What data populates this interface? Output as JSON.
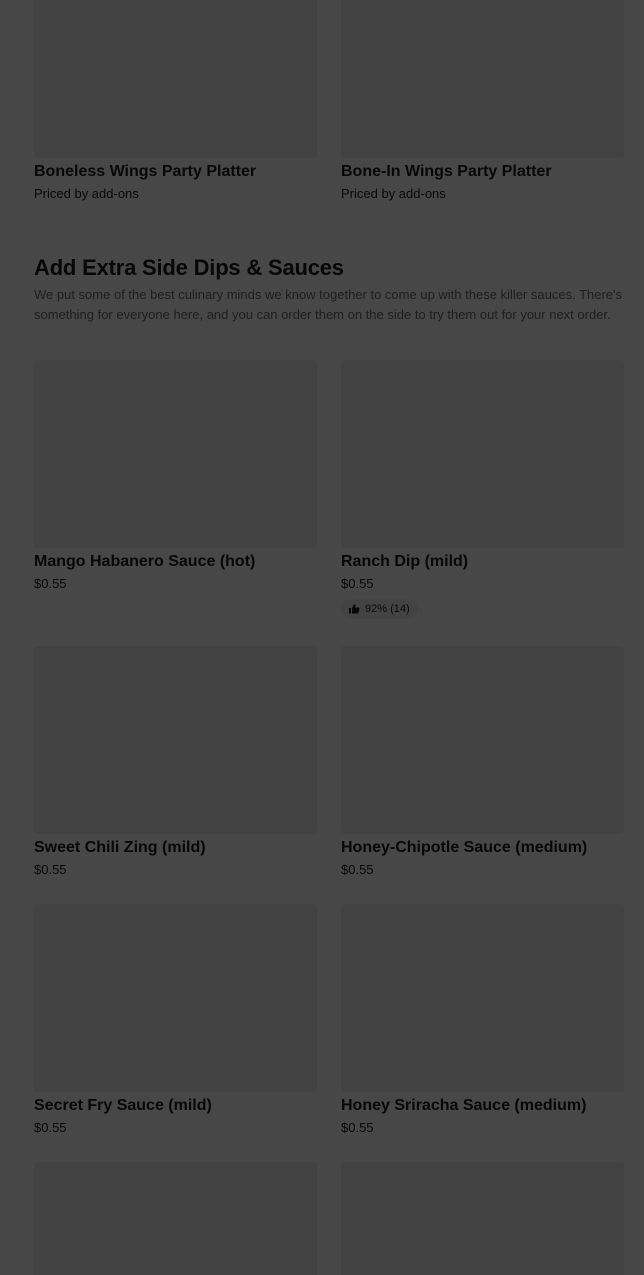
{
  "top_items": [
    {
      "name": "Boneless Wings Party Platter",
      "price": "Priced by add-ons"
    },
    {
      "name": "Bone-In Wings Party Platter",
      "price": "Priced by add-ons"
    }
  ],
  "section": {
    "title": "Add Extra Side Dips & Sauces",
    "description": "We put some of the best culinary minds we know together to come up with these killer sauces. There's something for everyone here, and you can order them on the side to try them out for your next order."
  },
  "items": [
    {
      "name": "Mango Habanero Sauce (hot)",
      "price": "$0.55"
    },
    {
      "name": "Ranch Dip (mild)",
      "price": "$0.55",
      "rating": "92% (14)"
    },
    {
      "name": "Sweet Chili Zing (mild)",
      "price": "$0.55"
    },
    {
      "name": "Honey-Chipotle Sauce (medium)",
      "price": "$0.55"
    },
    {
      "name": "Secret Fry Sauce (mild)",
      "price": "$0.55"
    },
    {
      "name": "Honey Sriracha Sauce (medium)",
      "price": "$0.55"
    }
  ],
  "icons": {
    "rating": "thumbs-up-icon"
  },
  "colors": {
    "overlay": "#000000",
    "image_placeholder": "#eeeeee",
    "muted_text": "#6b6b6b"
  }
}
